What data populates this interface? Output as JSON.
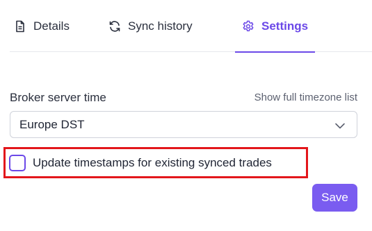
{
  "tabs": {
    "details": {
      "label": "Details",
      "icon": "document-icon"
    },
    "sync_history": {
      "label": "Sync history",
      "icon": "refresh-icon"
    },
    "settings": {
      "label": "Settings",
      "icon": "gear-icon",
      "active": true
    }
  },
  "settings_form": {
    "broker_time_label": "Broker server time",
    "timezone_link": "Show full timezone list",
    "timezone_value": "Europe DST",
    "update_timestamps_label": "Update timestamps for existing synced trades",
    "update_timestamps_checked": false,
    "save_label": "Save"
  },
  "colors": {
    "accent": "#6b48e8",
    "save_button": "#7a5cf0",
    "highlight_border": "#e3161b"
  }
}
